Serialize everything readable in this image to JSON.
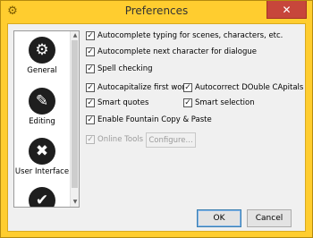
{
  "window": {
    "title": "Preferences",
    "close_label": "✕"
  },
  "sidebar": {
    "items": [
      {
        "label": "General",
        "icon": "gear-icon"
      },
      {
        "label": "Editing",
        "icon": "pen-icon"
      },
      {
        "label": "User Interface",
        "icon": "tools-icon"
      },
      {
        "label": "",
        "icon": "checkmark-icon"
      }
    ]
  },
  "options": {
    "autocomplete_typing": "Autocomplete typing for scenes, characters, etc.",
    "autocomplete_next": "Autocomplete next character for dialogue",
    "spell_checking": "Spell checking",
    "autocapitalize": "Autocapitalize first word",
    "autocorrect_double_caps": "Autocorrect DOuble CApitals",
    "smart_quotes": "Smart quotes",
    "smart_selection": "Smart selection",
    "fountain_copy_paste": "Enable Fountain Copy & Paste",
    "online_tools": "Online Tools",
    "configure_label": "Configure...",
    "check_glyph": "✓"
  },
  "buttons": {
    "ok": "OK",
    "cancel": "Cancel"
  }
}
